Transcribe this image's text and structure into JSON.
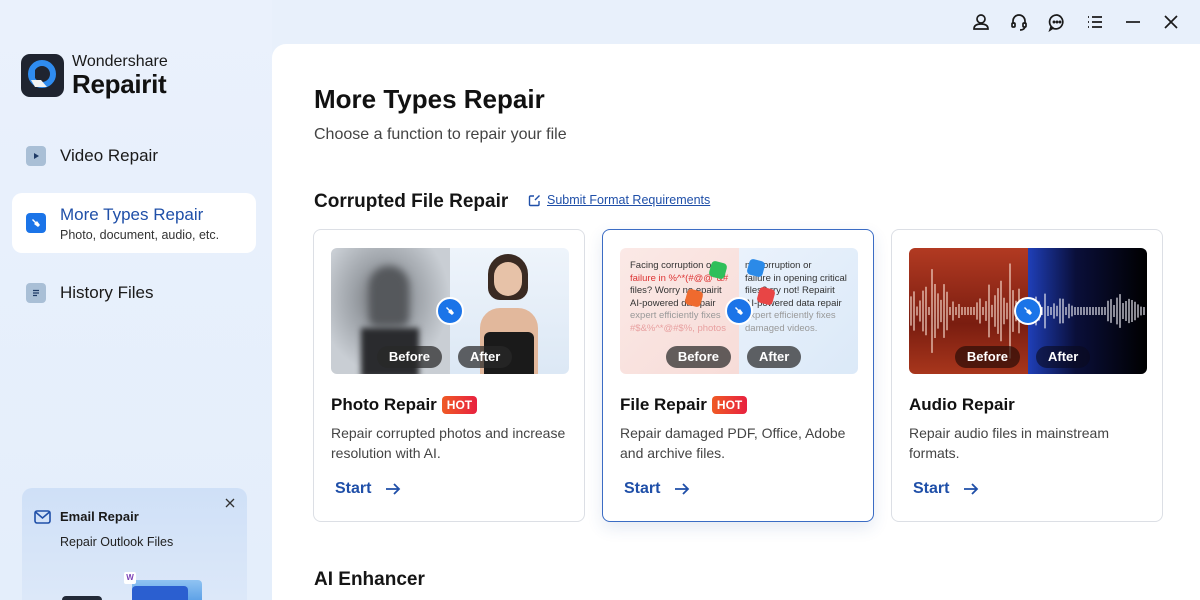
{
  "titlebar": {
    "buttons": [
      {
        "name": "account",
        "icon": "user-icon"
      },
      {
        "name": "support",
        "icon": "headset-icon"
      },
      {
        "name": "feedback",
        "icon": "chat-icon"
      },
      {
        "name": "menu",
        "icon": "list-menu-icon"
      },
      {
        "name": "minimize",
        "icon": "minimize-icon"
      },
      {
        "name": "close",
        "icon": "close-icon"
      }
    ]
  },
  "app": {
    "brand": "Wondershare",
    "product": "Repairit"
  },
  "sidebar": {
    "items": [
      {
        "label": "Video Repair",
        "icon": "video-icon",
        "active": false
      },
      {
        "label": "More Types Repair",
        "sub": "Photo, document, audio, etc.",
        "icon": "wrench-icon",
        "active": true
      },
      {
        "label": "History Files",
        "icon": "document-list-icon",
        "active": false
      }
    ],
    "promo": {
      "title": "Email Repair",
      "subtitle": "Repair Outlook Files",
      "badge": "W"
    }
  },
  "main": {
    "title": "More Types Repair",
    "subtitle": "Choose a function to repair your file",
    "sections": [
      {
        "title": "Corrupted File Repair",
        "link": "Submit Format Requirements",
        "cards": [
          {
            "title": "Photo Repair",
            "hot": "HOT",
            "description": "Repair corrupted photos and increase resolution with AI.",
            "before": "Before",
            "after": "After",
            "action": "Start",
            "selected": false
          },
          {
            "title": "File Repair",
            "hot": "HOT",
            "description": "Repair damaged PDF, Office, Adobe and archive files.",
            "before": "Before",
            "after": "After",
            "action": "Start",
            "selected": true,
            "preview_before": [
              "Facing corruption o",
              "failure in %^*(#@@*&#",
              "files? Worry no   epairit",
              "AI-powered da   epair",
              "expert efficiently fixes",
              "#$&%^*@#$%, photos"
            ],
            "preview_after": [
              "  ng corruption or",
              "failure in opening critical",
              "files?   rry not! Repairit",
              "AI-powered data repair",
              "expert efficiently fixes",
              "damaged videos."
            ]
          },
          {
            "title": "Audio Repair",
            "hot": "",
            "description": "Repair audio files in mainstream formats.",
            "before": "Before",
            "after": "After",
            "action": "Start",
            "selected": false
          }
        ]
      },
      {
        "title": "AI Enhancer"
      }
    ]
  },
  "colors": {
    "accent": "#1f4fa8",
    "primary_blue": "#1b74e8",
    "hot_badge": "#e8213f",
    "sidebar_bg": "#e8f0fb"
  }
}
